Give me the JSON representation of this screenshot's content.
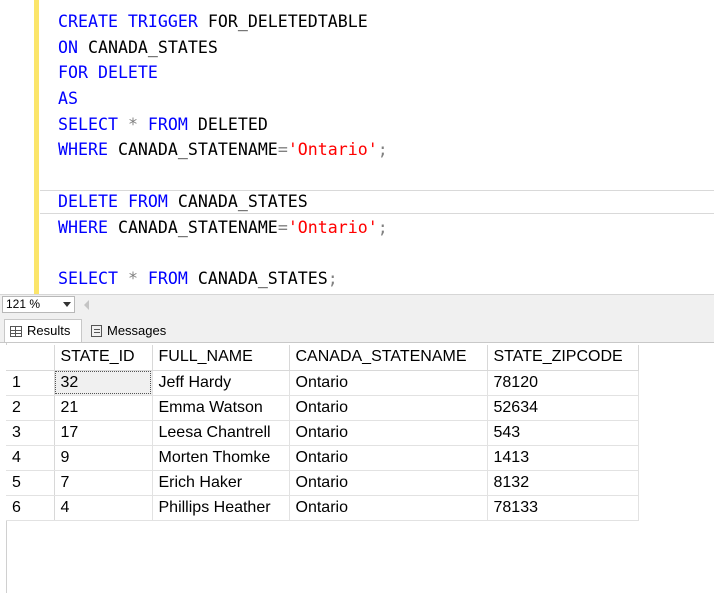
{
  "editor": {
    "lines": [
      [
        {
          "t": "CREATE TRIGGER ",
          "c": "kw"
        },
        {
          "t": "FOR_DELETEDTABLE",
          "c": ""
        }
      ],
      [
        {
          "t": "ON ",
          "c": "kw"
        },
        {
          "t": "CANADA_STATES",
          "c": ""
        }
      ],
      [
        {
          "t": "FOR DELETE",
          "c": "kw"
        }
      ],
      [
        {
          "t": "AS",
          "c": "kw"
        }
      ],
      [
        {
          "t": "SELECT ",
          "c": "kw"
        },
        {
          "t": "* ",
          "c": "op"
        },
        {
          "t": "FROM ",
          "c": "kw"
        },
        {
          "t": "DELETED",
          "c": ""
        }
      ],
      [
        {
          "t": "WHERE ",
          "c": "kw"
        },
        {
          "t": "CANADA_STATENAME",
          "c": ""
        },
        {
          "t": "=",
          "c": "op"
        },
        {
          "t": "'Ontario'",
          "c": "str"
        },
        {
          "t": ";",
          "c": "op"
        }
      ],
      [],
      [
        {
          "t": "DELETE ",
          "c": "kw"
        },
        {
          "t": "FROM ",
          "c": "kw"
        },
        {
          "t": "CANADA_STATES",
          "c": ""
        }
      ],
      [
        {
          "t": "WHERE ",
          "c": "kw"
        },
        {
          "t": "CANADA_STATENAME",
          "c": ""
        },
        {
          "t": "=",
          "c": "op"
        },
        {
          "t": "'Ontario'",
          "c": "str"
        },
        {
          "t": ";",
          "c": "op"
        }
      ],
      [],
      [
        {
          "t": "SELECT ",
          "c": "kw"
        },
        {
          "t": "* ",
          "c": "op"
        },
        {
          "t": "FROM ",
          "c": "kw"
        },
        {
          "t": "CANADA_STATES",
          "c": ""
        },
        {
          "t": ";",
          "c": "op"
        }
      ]
    ]
  },
  "zoom": {
    "value": "121 %"
  },
  "tabs": {
    "results_label": "Results",
    "messages_label": "Messages"
  },
  "results": {
    "columns": [
      "STATE_ID",
      "FULL_NAME",
      "CANADA_STATENAME",
      "STATE_ZIPCODE"
    ],
    "rows": [
      {
        "num": "1",
        "cells": [
          "32",
          "Jeff Hardy",
          "Ontario",
          "78120"
        ]
      },
      {
        "num": "2",
        "cells": [
          "21",
          "Emma Watson",
          "Ontario",
          "52634"
        ]
      },
      {
        "num": "3",
        "cells": [
          "17",
          "Leesa Chantrell",
          "Ontario",
          "543"
        ]
      },
      {
        "num": "4",
        "cells": [
          "9",
          "Morten Thomke",
          "Ontario",
          "1413"
        ]
      },
      {
        "num": "5",
        "cells": [
          "7",
          "Erich Haker",
          "Ontario",
          "8132"
        ]
      },
      {
        "num": "6",
        "cells": [
          "4",
          "Phillips Heather",
          "Ontario",
          "78133"
        ]
      }
    ]
  },
  "colors": {
    "keyword": "#0000ff",
    "string": "#ff0000",
    "operator": "#808080",
    "change_bar": "#fbe56a"
  }
}
